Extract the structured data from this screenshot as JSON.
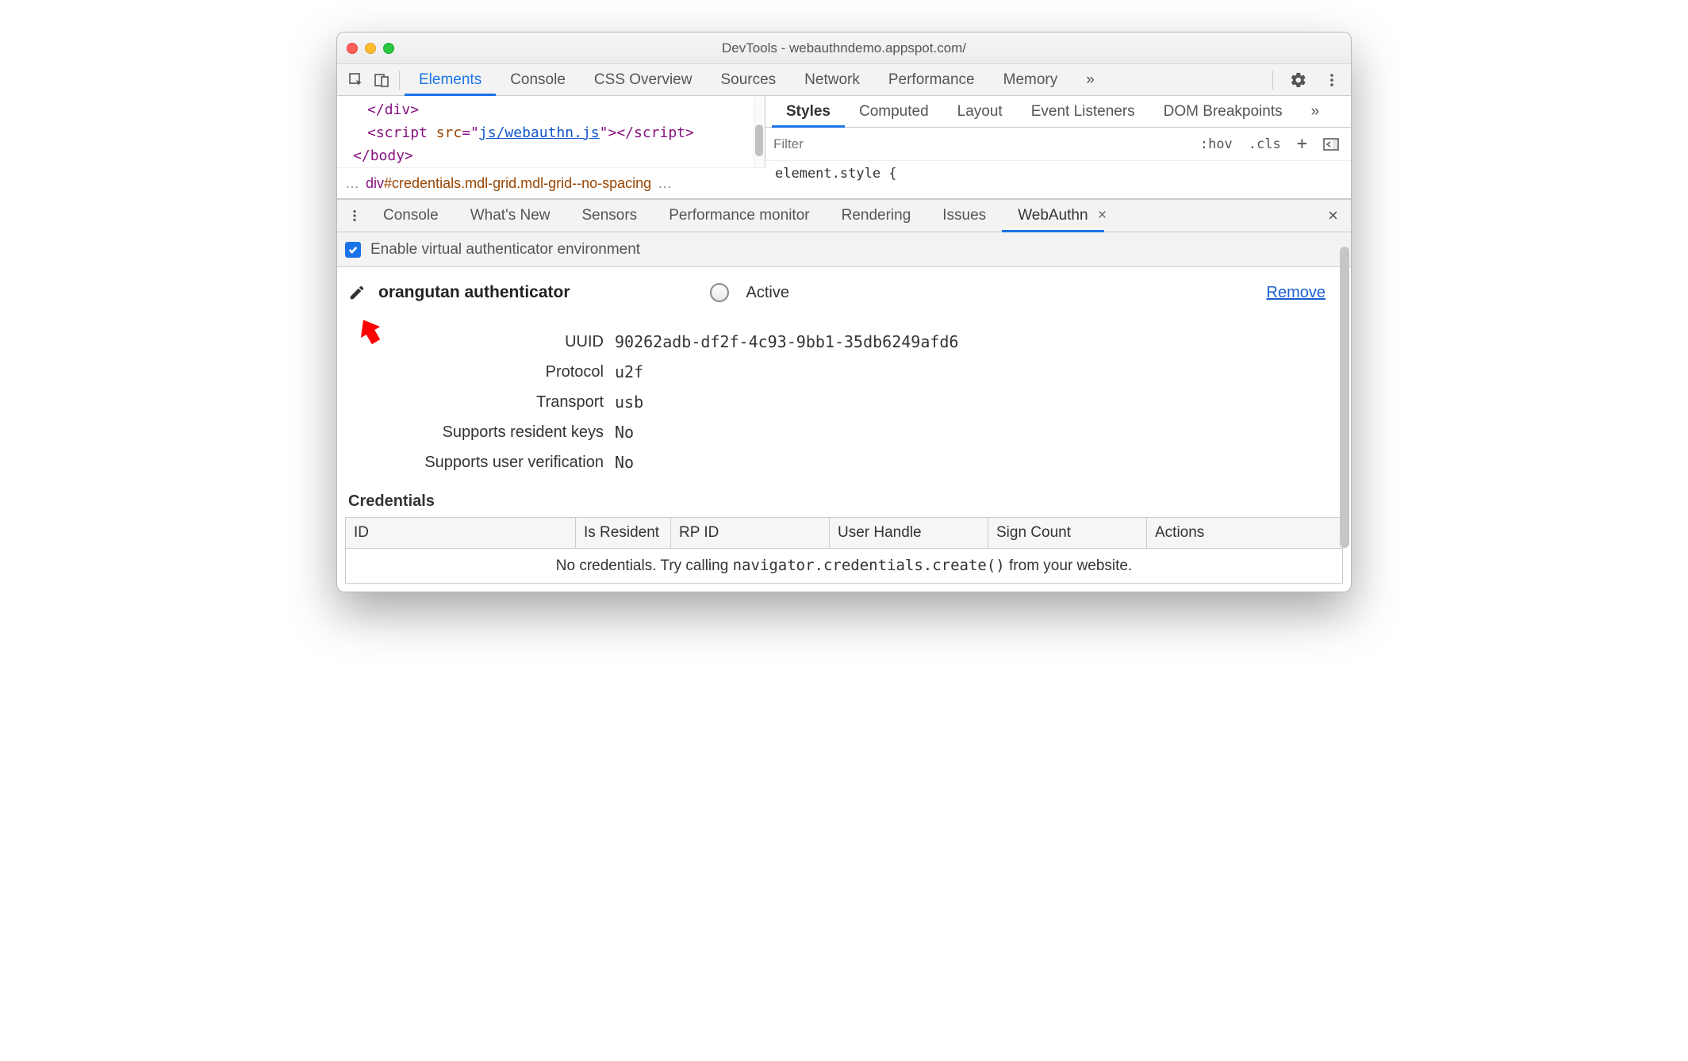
{
  "window": {
    "title": "DevTools - webauthndemo.appspot.com/"
  },
  "topTabs": {
    "items": [
      "Elements",
      "Console",
      "CSS Overview",
      "Sources",
      "Network",
      "Performance",
      "Memory"
    ],
    "activeIndex": 0,
    "overflow": "»"
  },
  "codeSnippet": {
    "line1_open": "</",
    "line1_tag": "div",
    "line1_close": ">",
    "line2_open": "<",
    "line2_tag": "script ",
    "line2_attr": "src",
    "line2_eq": "=\"",
    "line2_val": "js/webauthn.js",
    "line2_endq": "\">",
    "line2_close_open": "</",
    "line2_close_tag": "script",
    "line2_close_end": ">",
    "line3_open": "</",
    "line3_tag": "body",
    "line3_close": ">"
  },
  "breadcrumb": {
    "dots_left": "…",
    "el": "div",
    "id": "#credentials",
    "classes": ".mdl-grid.mdl-grid--no-spacing",
    "dots_right": "…"
  },
  "stylesTabs": {
    "items": [
      "Styles",
      "Computed",
      "Layout",
      "Event Listeners",
      "DOM Breakpoints"
    ],
    "activeIndex": 0,
    "overflow": "»"
  },
  "stylesFilter": {
    "placeholder": "Filter",
    "hov": ":hov",
    "cls": ".cls",
    "body": "element.style {"
  },
  "drawerTabs": {
    "items": [
      "Console",
      "What's New",
      "Sensors",
      "Performance monitor",
      "Rendering",
      "Issues",
      "WebAuthn"
    ],
    "activeIndex": 6
  },
  "enable": {
    "label": "Enable virtual authenticator environment",
    "checked": true
  },
  "authenticator": {
    "name": "orangutan authenticator",
    "activeLabel": "Active",
    "removeLabel": "Remove",
    "details": [
      {
        "label": "UUID",
        "value": "90262adb-df2f-4c93-9bb1-35db6249afd6"
      },
      {
        "label": "Protocol",
        "value": "u2f"
      },
      {
        "label": "Transport",
        "value": "usb"
      },
      {
        "label": "Supports resident keys",
        "value": "No"
      },
      {
        "label": "Supports user verification",
        "value": "No"
      }
    ]
  },
  "credentials": {
    "heading": "Credentials",
    "columns": [
      "ID",
      "Is Resident",
      "RP ID",
      "User Handle",
      "Sign Count",
      "Actions"
    ],
    "empty_pre": "No credentials. Try calling ",
    "empty_code": "navigator.credentials.create()",
    "empty_post": " from your website."
  }
}
